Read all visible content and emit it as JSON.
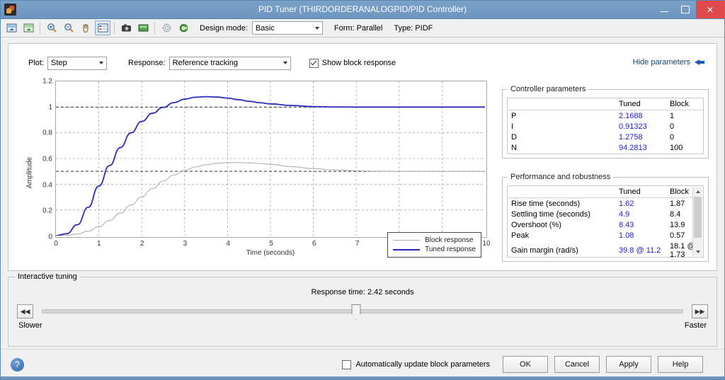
{
  "window": {
    "title": "PID Tuner (THIRDORDERANALOGPID/PID Controller)",
    "minimize_label": "",
    "maximize_label": "",
    "close_label": "✕"
  },
  "toolbar": {
    "icons": [
      "add-plot-icon",
      "add-plot-alt-icon",
      "zoom-in-icon",
      "zoom-out-icon",
      "pan-icon",
      "legend-icon",
      "snapshot-icon",
      "export-icon",
      "options-icon",
      "reset-icon"
    ],
    "design_mode_label": "Design mode:",
    "design_mode_value": "Basic",
    "form_label": "Form: Parallel",
    "type_label": "Type: PIDF"
  },
  "controls": {
    "plot_label": "Plot:",
    "plot_value": "Step",
    "response_label": "Response:",
    "response_value": "Reference tracking",
    "show_block_response_label": "Show block response",
    "show_block_response_checked": true,
    "hide_parameters_label": "Hide parameters"
  },
  "chart_data": {
    "type": "line",
    "title": "",
    "xlabel": "Time (seconds)",
    "ylabel": "Amplitude",
    "xlim": [
      0,
      10
    ],
    "ylim": [
      0,
      1.2
    ],
    "xticks": [
      0,
      1,
      2,
      3,
      4,
      5,
      6,
      7,
      8,
      9,
      10
    ],
    "yticks": [
      0,
      0.2,
      0.4,
      0.6,
      0.8,
      1,
      1.2
    ],
    "ytick_labels": [
      "0",
      "0.2",
      "0.4",
      "0.6",
      "0.8",
      "1",
      "1.2"
    ],
    "grid": true,
    "legend_position": "lower right",
    "series": [
      {
        "name": "Block response",
        "color": "#b0b0b0",
        "x": [
          0,
          0.25,
          0.5,
          0.75,
          1,
          1.25,
          1.5,
          1.75,
          2,
          2.25,
          2.5,
          2.75,
          3,
          3.25,
          3.5,
          3.75,
          4,
          4.25,
          4.5,
          4.75,
          5,
          5.5,
          6,
          6.5,
          7,
          7.5,
          8,
          8.5,
          9,
          9.5,
          10
        ],
        "y": [
          0,
          0.003,
          0.013,
          0.035,
          0.07,
          0.118,
          0.175,
          0.238,
          0.302,
          0.366,
          0.425,
          0.472,
          0.508,
          0.534,
          0.552,
          0.563,
          0.568,
          0.569,
          0.566,
          0.561,
          0.554,
          0.537,
          0.521,
          0.511,
          0.505,
          0.502,
          0.5,
          0.5,
          0.5,
          0.5,
          0.5
        ]
      },
      {
        "name": "Tuned response",
        "color": "#2b2bbd",
        "x": [
          0,
          0.25,
          0.5,
          0.75,
          1,
          1.25,
          1.5,
          1.75,
          2,
          2.25,
          2.5,
          2.75,
          3,
          3.25,
          3.5,
          3.75,
          4,
          4.25,
          4.5,
          4.75,
          5,
          5.5,
          6,
          6.5,
          7,
          7.5,
          8,
          8.5,
          9,
          9.5,
          10
        ],
        "y": [
          0,
          0.015,
          0.085,
          0.22,
          0.385,
          0.545,
          0.685,
          0.8,
          0.888,
          0.952,
          0.998,
          1.035,
          1.062,
          1.077,
          1.081,
          1.078,
          1.07,
          1.058,
          1.045,
          1.034,
          1.025,
          1.012,
          1.004,
          1.001,
          1.0,
          1.0,
          1.0,
          1.0,
          1.0,
          1.0,
          1.0
        ]
      }
    ],
    "reference_lines": [
      {
        "y": 1,
        "style": "dashed"
      },
      {
        "y": 0.5,
        "style": "dashed"
      }
    ]
  },
  "controller_parameters": {
    "caption": "Controller parameters",
    "columns": [
      "",
      "Tuned",
      "Block"
    ],
    "rows": [
      {
        "name": "P",
        "tuned": "2.1688",
        "block": "1"
      },
      {
        "name": "I",
        "tuned": "0.91323",
        "block": "0"
      },
      {
        "name": "D",
        "tuned": "1.2758",
        "block": "0"
      },
      {
        "name": "N",
        "tuned": "94.2813",
        "block": "100"
      }
    ]
  },
  "performance": {
    "caption": "Performance and robustness",
    "columns": [
      "",
      "Tuned",
      "Block"
    ],
    "rows": [
      {
        "name": "Rise time (seconds)",
        "tuned": "1.62",
        "block": "1.87"
      },
      {
        "name": "Settling time (seconds)",
        "tuned": "4.9",
        "block": "8.4"
      },
      {
        "name": "Overshoot (%)",
        "tuned": "8.43",
        "block": "13.9"
      },
      {
        "name": "Peak",
        "tuned": "1.08",
        "block": "0.57"
      },
      {
        "name": "Gain margin (rad/s)",
        "tuned": "39.8 @ 11.2",
        "block": "18.1 @ 1.73"
      }
    ]
  },
  "interactive_tuning": {
    "caption": "Interactive tuning",
    "response_time_label": "Response time: 2.42 seconds",
    "slider_percent": 49,
    "slower_label": "Slower",
    "faster_label": "Faster",
    "slower_nudge": "◀◀",
    "faster_nudge": "▶▶"
  },
  "footer": {
    "help_glyph": "?",
    "auto_update_label": "Automatically update block parameters",
    "auto_update_checked": false,
    "buttons": [
      "OK",
      "Cancel",
      "Apply",
      "Help"
    ]
  },
  "colors": {
    "accent": "#6e95bf",
    "tuned": "#2222cc",
    "block": "#b0b0b0",
    "close": "#e04a4a"
  }
}
